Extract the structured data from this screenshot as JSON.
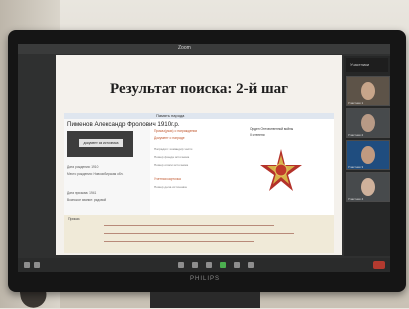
{
  "meeting": {
    "topbar_label": "Zoom",
    "participants_title": "Участники"
  },
  "slide": {
    "title": "Результат поиска: 2-й шаг",
    "browser_tab": "Память народа",
    "person_name": "Пименов Александр Фролович 1910г.р.",
    "document_button": "документ из источника",
    "left_lines": [
      "Дата рождения: 1910",
      "Место рождения: Новосибирская обл.",
      "Дата призыва: 1941",
      "Воинское звание: рядовой"
    ],
    "mid_lines": [
      {
        "text": "Приказ(указ) о награждении",
        "style": "orange"
      },
      {
        "text": "Документ о награде",
        "style": "orange"
      },
      {
        "text": "Наградил: командир части",
        "style": "grey"
      },
      {
        "text": "Номер фонда источника",
        "style": "grey"
      },
      {
        "text": "Номер описи источника",
        "style": "grey"
      },
      {
        "text": "Учетная карточка",
        "style": "orange"
      },
      {
        "text": "Номер дела источника",
        "style": "grey"
      }
    ],
    "award_label": "Орден Отечественной войны",
    "award_degree": "II степени",
    "strip_label": "Приказ"
  },
  "participants": [
    "Участник 1",
    "Участник 2",
    "Участник 3",
    "Участник 4"
  ],
  "device_brand": "PHILIPS"
}
